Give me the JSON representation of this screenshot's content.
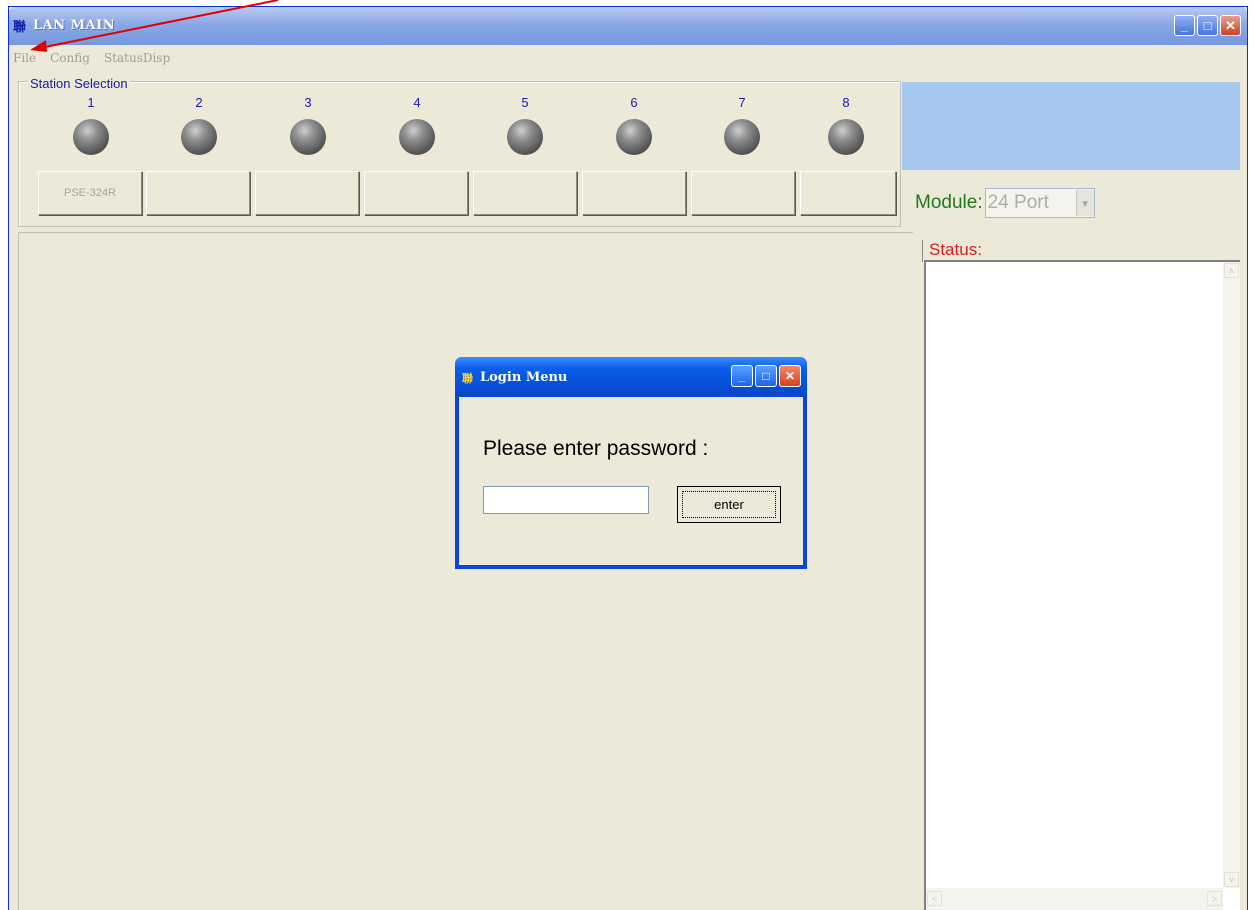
{
  "main_window": {
    "title": "LAN MAIN",
    "icon_glyph": "聯",
    "controls": {
      "minimize": "_",
      "maximize": "□",
      "close": "✕"
    }
  },
  "menu": {
    "items": [
      "File",
      "Config",
      "StatusDisp"
    ]
  },
  "station_selection": {
    "legend": "Station Selection",
    "stations": [
      {
        "number": "1",
        "button_label": "PSE-324R"
      },
      {
        "number": "2",
        "button_label": ""
      },
      {
        "number": "3",
        "button_label": ""
      },
      {
        "number": "4",
        "button_label": ""
      },
      {
        "number": "5",
        "button_label": ""
      },
      {
        "number": "6",
        "button_label": ""
      },
      {
        "number": "7",
        "button_label": ""
      },
      {
        "number": "8",
        "button_label": ""
      }
    ]
  },
  "module": {
    "label": "Module:",
    "selected": "24 Port",
    "arrow_glyph": "▾"
  },
  "status": {
    "label": "Status:",
    "scroll_up": "˄",
    "scroll_down": "˅",
    "scroll_left": "<",
    "scroll_right": ">"
  },
  "login_dialog": {
    "title": "Login Menu",
    "icon_glyph": "聯",
    "prompt": "Please enter password :",
    "password_value": "",
    "enter_label": "enter",
    "controls": {
      "minimize": "_",
      "maximize": "□",
      "close": "✕"
    }
  },
  "colors": {
    "annotation_arrow": "#e00000",
    "window_face": "#ece9d8",
    "status_label": "#d02020",
    "module_label": "#1f7a1f",
    "station_text": "#1a1aa8",
    "blue_panel": "#a6c7ee"
  }
}
